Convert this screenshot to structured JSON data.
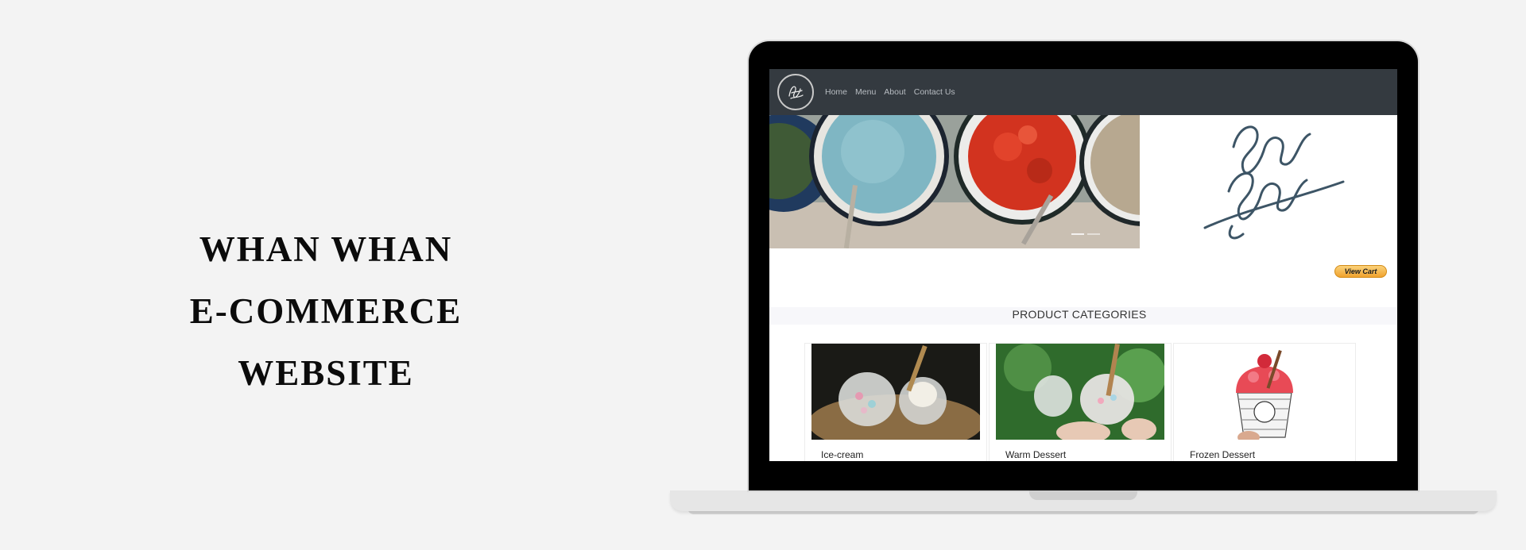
{
  "headline": {
    "line1": "WHAN WHAN",
    "line2": "E-COMMERCE WEBSITE"
  },
  "site": {
    "nav": {
      "logo_icon": "round-script-logo-icon",
      "links": [
        "Home",
        "Menu",
        "About",
        "Contact Us"
      ]
    },
    "hero": {
      "image": "toppings-bowls-photo",
      "brand_logo": "script-brand-logo"
    },
    "view_cart_label": "View Cart",
    "categories_title": "PRODUCT CATEGORIES",
    "categories": [
      {
        "label": "Ice-cream",
        "image": "ice-cream-jars-photo"
      },
      {
        "label": "Warm Dessert",
        "image": "warm-dessert-jar-photo"
      },
      {
        "label": "Frozen Dessert",
        "image": "frozen-dessert-cup-photo"
      }
    ]
  },
  "colors": {
    "page_background": "#f3f3f3",
    "nav_background": "#343a40",
    "nav_link": "#b7bcc1",
    "view_cart_button": "#f0a22e",
    "brand_logo": "#3d5566"
  }
}
